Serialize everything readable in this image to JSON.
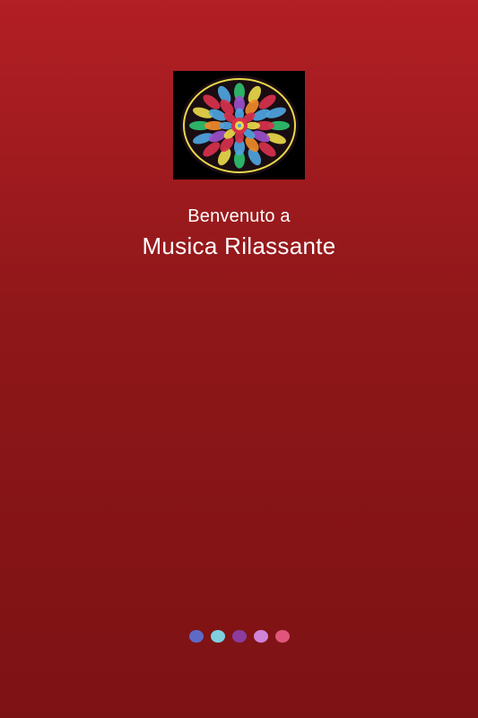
{
  "logo": {
    "icon": "kaleidoscope-mandala-icon",
    "colors": [
      "#000000",
      "#e8d84a",
      "#2fbf6f",
      "#d7314c",
      "#4ea4e0",
      "#9b4fc8",
      "#f08a2a"
    ]
  },
  "welcome": {
    "line1": "Benvenuto a",
    "line2": "Musica Rilassante"
  },
  "theme": {
    "background_top": "#b21f24",
    "background_bottom": "#7d1214",
    "text_color": "#ffffff"
  },
  "page_indicator": {
    "dots": [
      {
        "color": "#5e6bc6",
        "state": "active"
      },
      {
        "color": "#7fcfe0",
        "state": "inactive"
      },
      {
        "color": "#8a3d9e",
        "state": "inactive"
      },
      {
        "color": "#cf84d8",
        "state": "inactive"
      },
      {
        "color": "#e0557c",
        "state": "inactive"
      }
    ]
  }
}
